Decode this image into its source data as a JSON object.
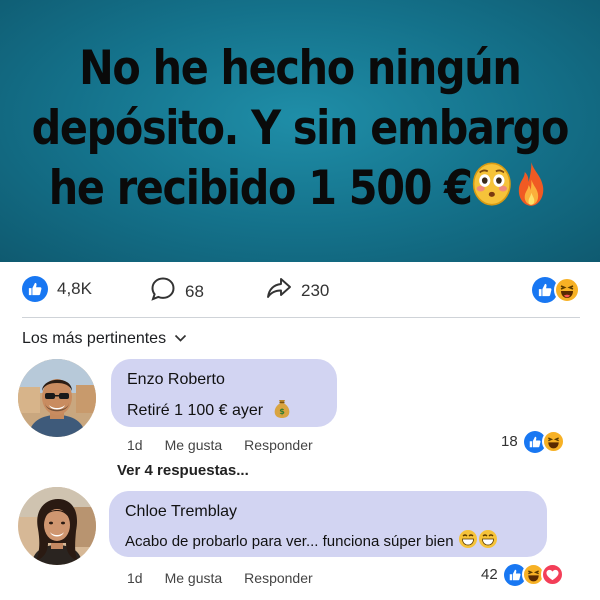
{
  "headline": {
    "line1": "No he hecho ningún",
    "line2": "depósito. Y sin embargo",
    "line3": "he recibido 1 500 €"
  },
  "stats": {
    "likes": "4,8K",
    "comments": "68",
    "shares": "230"
  },
  "sort_label": "Los más pertinentes",
  "comments": [
    {
      "author": "Enzo Roberto",
      "text": "Retiré 1 100 € ayer",
      "time": "1d",
      "like_label": "Me gusta",
      "reply_label": "Responder",
      "reaction_count": "18",
      "emoji": "money-bag-icon"
    },
    {
      "author": "Chloe Tremblay",
      "text": "Acabo de probarlo para ver... funciona súper bien",
      "time": "1d",
      "like_label": "Me gusta",
      "reply_label": "Responder",
      "reaction_count": "42",
      "emoji": "grinning-sweat-icon"
    }
  ],
  "view_replies": "Ver 4 respuestas...",
  "colors": {
    "banner": "#14718a",
    "like_blue": "#1877f2",
    "haha_yellow": "#f7b125",
    "love_red": "#f33e58",
    "bubble": "#d2d4f2"
  }
}
